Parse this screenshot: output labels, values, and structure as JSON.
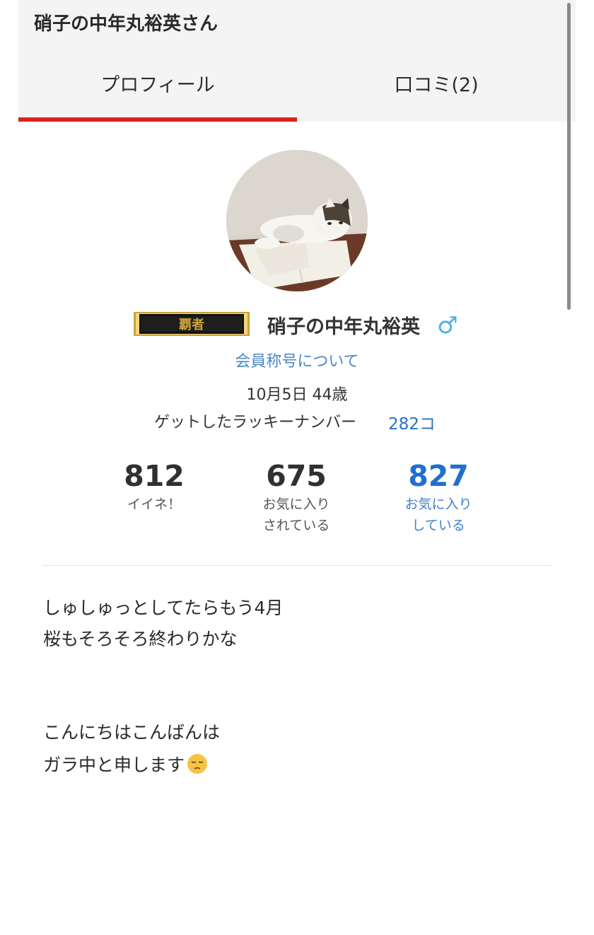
{
  "header": {
    "title": "硝子の中年丸裕英さん",
    "tabs": [
      {
        "label": "プロフィール",
        "active": true
      },
      {
        "label": "口コミ(2)",
        "active": false
      }
    ],
    "active_tab_color": "#d9201e"
  },
  "profile": {
    "avatar_icon": "cat-photo",
    "title_badge": {
      "text": "覇者",
      "icon": "gold-framed-rank-plate"
    },
    "name": "硝子の中年丸裕英",
    "gender_icon": "♂",
    "member_title_link": "会員称号について",
    "birthday_age": "10月5日 44歳",
    "lucky_number_label": "ゲットしたラッキーナンバー",
    "lucky_number_value": "282コ"
  },
  "stats": [
    {
      "number": "812",
      "label_line1": "イイネ！",
      "label_line2": ""
    },
    {
      "number": "675",
      "label_line1": "お気に入り",
      "label_line2": "されている"
    },
    {
      "number": "827",
      "label_line1": "お気に入り",
      "label_line2": "している"
    }
  ],
  "intro": {
    "lines": [
      "しゅしゅっとしてたらもう4月",
      "桜もそろそろ終わりかな",
      "こんにちはこんばんは",
      "ガラ中と申します"
    ],
    "trailing_emoji": "pensive-face-emoji"
  },
  "colors": {
    "link": "#4a86c5",
    "accent_blue": "#1f6fd1",
    "header_bg": "#f4f4f4"
  }
}
